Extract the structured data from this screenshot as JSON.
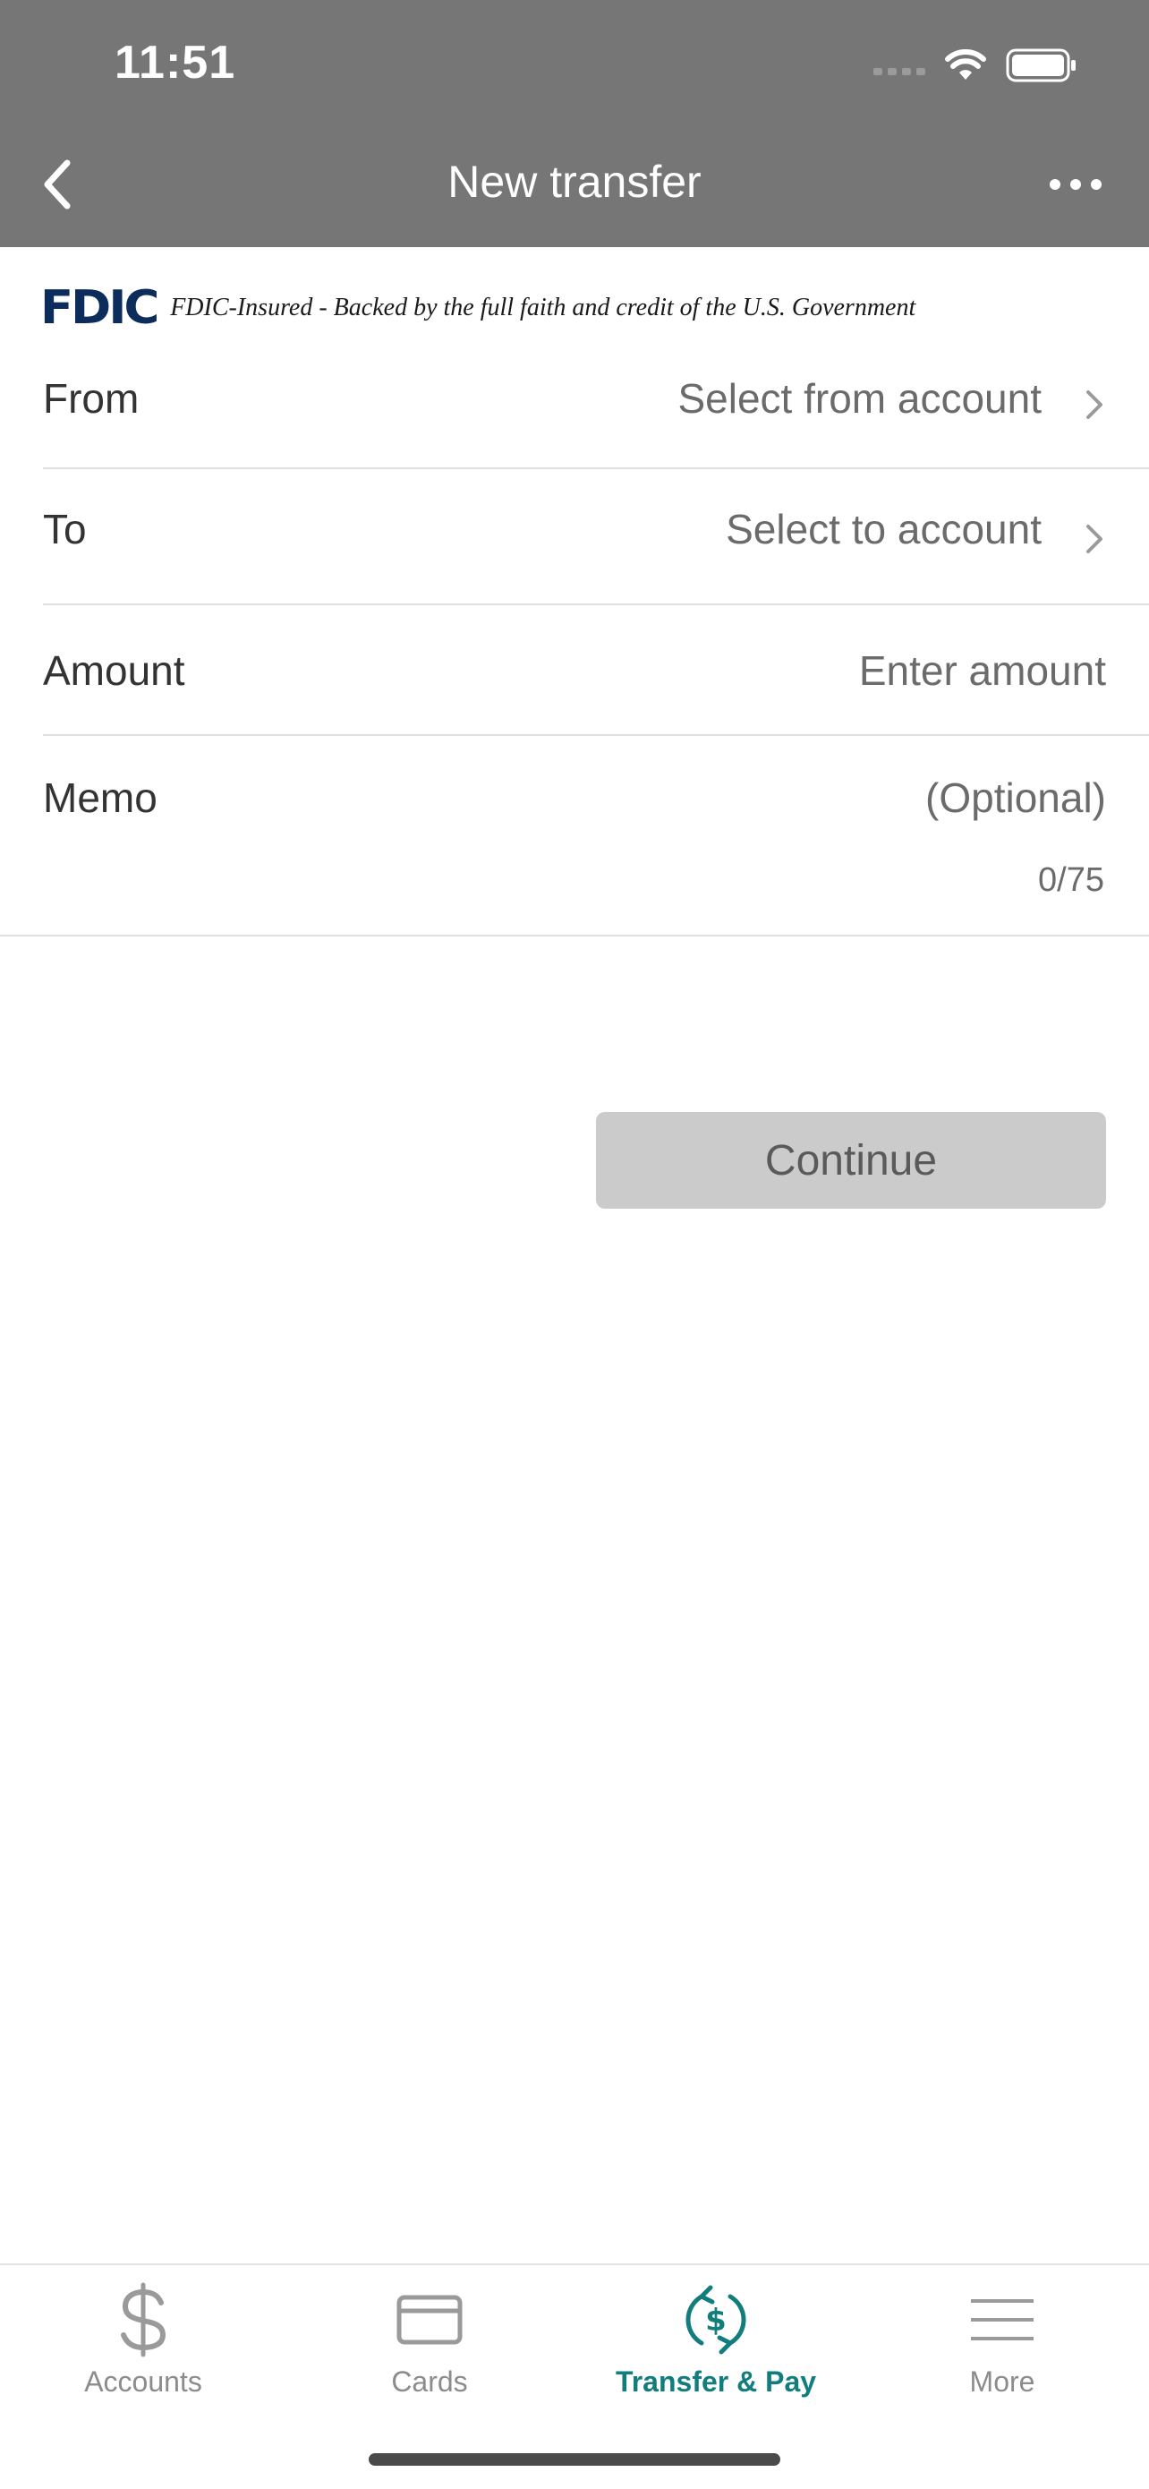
{
  "status_bar": {
    "time": "11:51"
  },
  "nav": {
    "title": "New transfer",
    "back_icon": "chevron-left-icon",
    "more_icon": "more-horizontal-icon"
  },
  "fdic": {
    "logo_text": "FDIC",
    "text": "FDIC-Insured - Backed by the full faith and credit of the U.S. Government"
  },
  "form": {
    "from": {
      "label": "From",
      "placeholder": "Select from account"
    },
    "to": {
      "label": "To",
      "placeholder": "Select to account"
    },
    "amount": {
      "label": "Amount",
      "placeholder": "Enter amount"
    },
    "memo": {
      "label": "Memo",
      "placeholder": "(Optional)",
      "counter": "0/75"
    }
  },
  "actions": {
    "continue_label": "Continue"
  },
  "tabbar": {
    "items": [
      {
        "label": "Accounts",
        "icon": "dollar-icon",
        "active": false
      },
      {
        "label": "Cards",
        "icon": "card-icon",
        "active": false
      },
      {
        "label": "Transfer & Pay",
        "icon": "transfer-pay-icon",
        "active": true
      },
      {
        "label": "More",
        "icon": "menu-icon",
        "active": false
      }
    ]
  },
  "colors": {
    "header_bg": "#767676",
    "accent": "#127d7d",
    "fdic_navy": "#0c2d5b",
    "button_disabled": "#cbcbcb"
  }
}
